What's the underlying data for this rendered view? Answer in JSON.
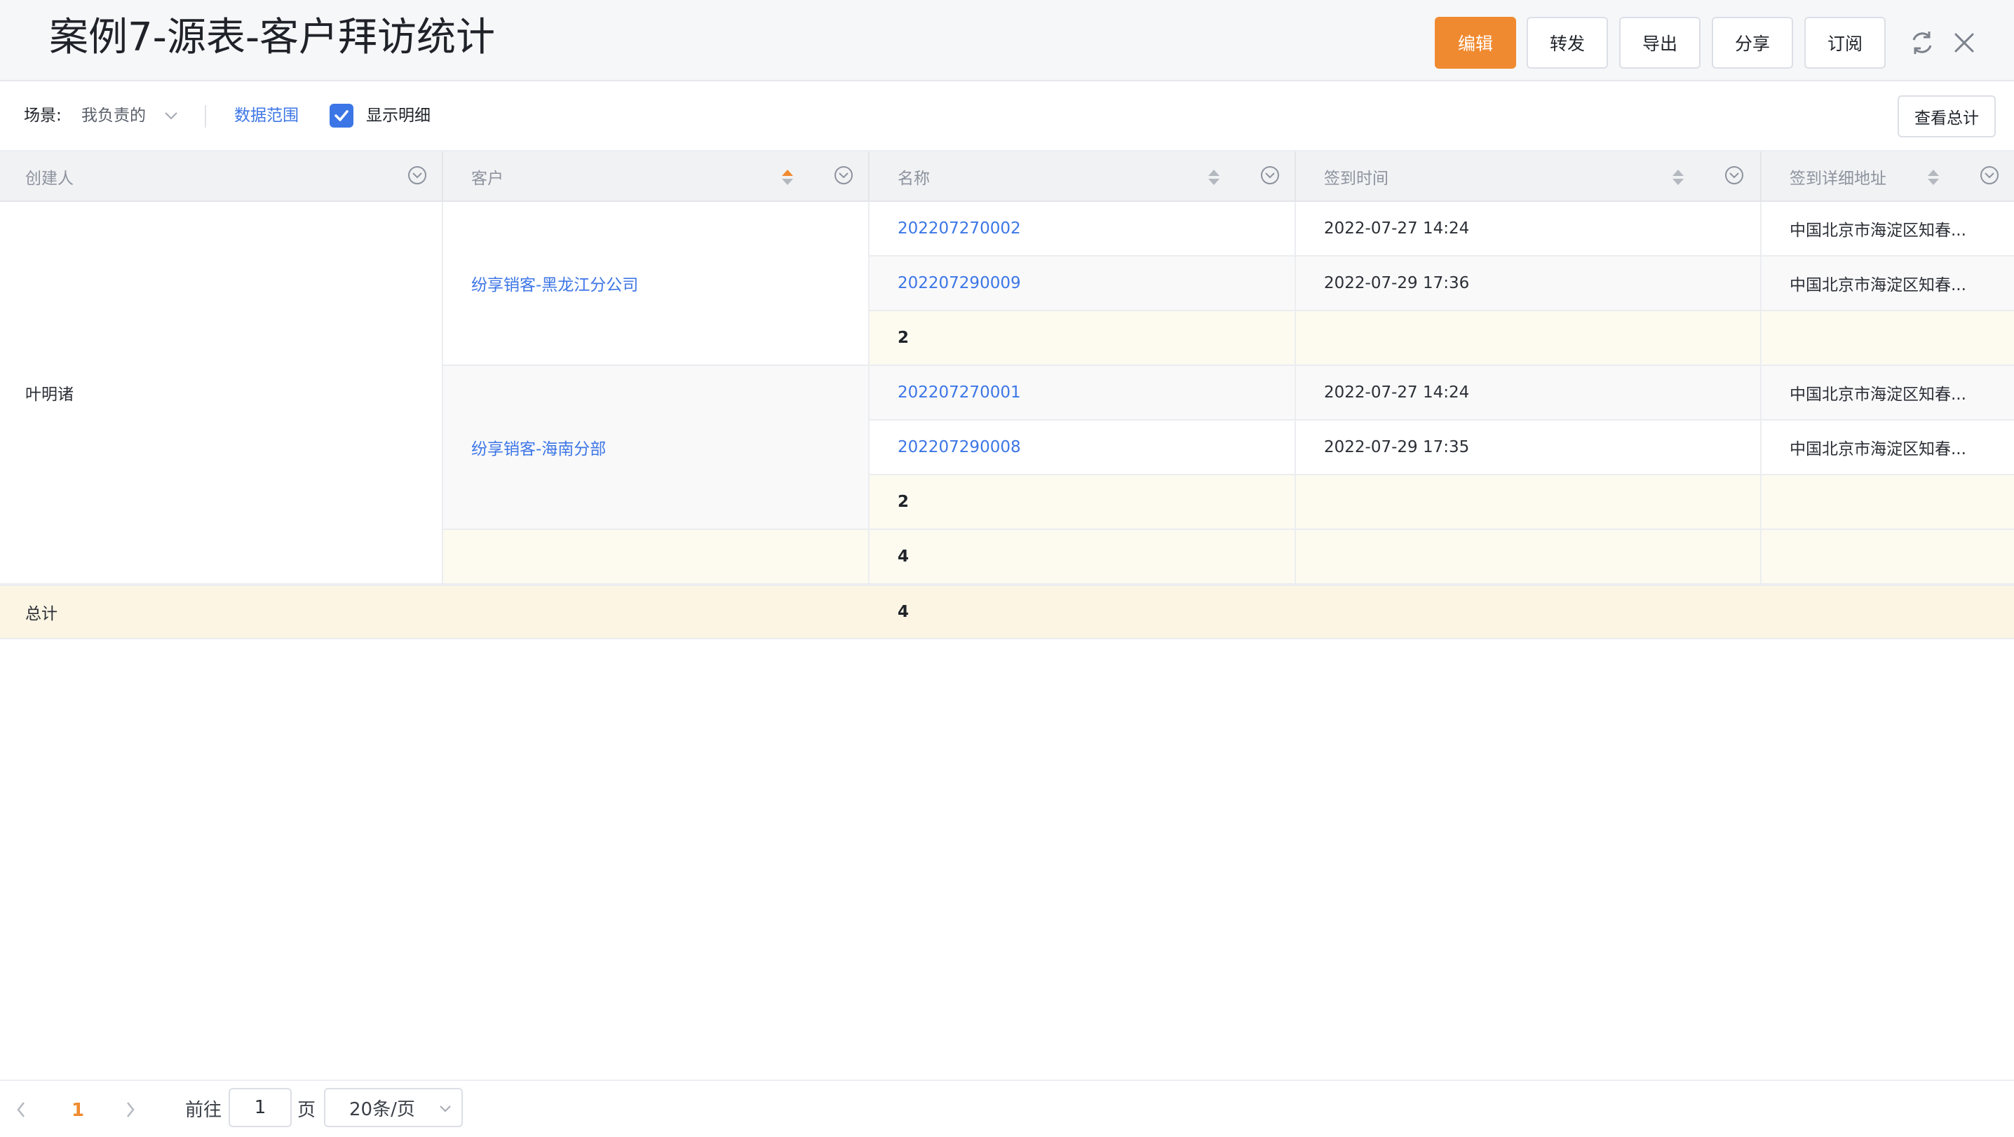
{
  "header": {
    "title": "案例7-源表-客户拜访统计",
    "buttons": {
      "edit": "编辑",
      "forward": "转发",
      "export": "导出",
      "share": "分享",
      "subscribe": "订阅"
    }
  },
  "toolbar": {
    "scene_label": "场景:",
    "scene_value": "我负责的",
    "data_scope": "数据范围",
    "show_detail": "显示明细",
    "show_detail_checked": true,
    "view_total": "查看总计"
  },
  "table": {
    "columns": [
      "创建人",
      "客户",
      "名称",
      "签到时间",
      "签到详细地址"
    ],
    "creator": "叶明诸",
    "groups": [
      {
        "customer": "纷享销客-黑龙江分公司",
        "rows": [
          {
            "name": "202207270002",
            "time": "2022-07-27 14:24",
            "address": "中国北京市海淀区知春..."
          },
          {
            "name": "202207290009",
            "time": "2022-07-29 17:36",
            "address": "中国北京市海淀区知春..."
          }
        ],
        "subtotal": "2"
      },
      {
        "customer": "纷享销客-海南分部",
        "rows": [
          {
            "name": "202207270001",
            "time": "2022-07-27 14:24",
            "address": "中国北京市海淀区知春..."
          },
          {
            "name": "202207290008",
            "time": "2022-07-29 17:35",
            "address": "中国北京市海淀区知春..."
          }
        ],
        "subtotal": "2"
      }
    ],
    "creator_subtotal": "4",
    "grand_total_label": "总计",
    "grand_total": "4"
  },
  "pagination": {
    "current_page": "1",
    "goto_label": "前往",
    "goto_value": "1",
    "page_unit": "页",
    "page_size": "20条/页"
  },
  "colors": {
    "accent": "#f08a30",
    "link": "#3c76e6",
    "subtotal_bg": "#fdfbf0",
    "total_bg": "#fcf5e3"
  }
}
